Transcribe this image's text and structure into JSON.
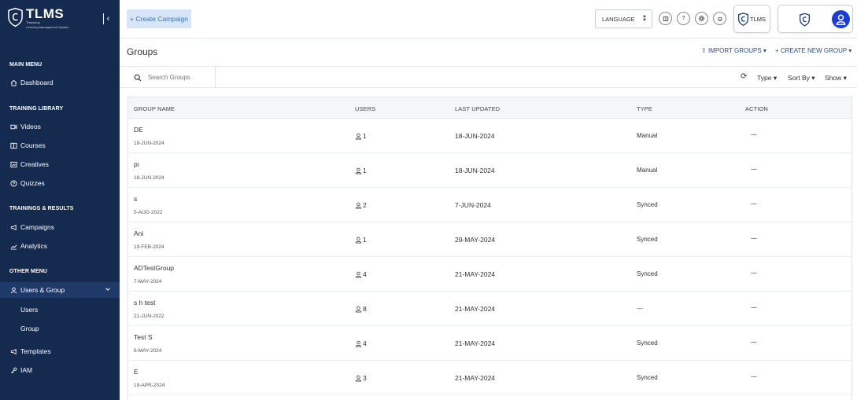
{
  "app": {
    "logo_title": "TLMS",
    "logo_subtitle_1": "Threatcop",
    "logo_subtitle_2": "Learning Management System"
  },
  "sidebar": {
    "sections": [
      {
        "heading": "MAIN MENU"
      },
      {
        "heading": "TRAINING LIBRARY"
      },
      {
        "heading": "TRAININGS & RESULTS"
      },
      {
        "heading": "OTHER MENU"
      }
    ],
    "items": {
      "dashboard": "Dashboard",
      "videos": "Videos",
      "courses": "Courses",
      "creatives": "Creatives",
      "quizzes": "Quizzes",
      "campaigns": "Campaigns",
      "analytics": "Analytics",
      "users_group": "Users & Group",
      "users": "Users",
      "group": "Group",
      "templates": "Templates",
      "iam": "IAM"
    }
  },
  "topbar": {
    "create_campaign": "+ Create Campaign",
    "language": "LANGUAGE",
    "tlms_label": "TLMS"
  },
  "page": {
    "title": "Groups",
    "import_groups": "IMPORT GROUPS",
    "create_new_group": "CREATE NEW GROUP"
  },
  "filters": {
    "search_placeholder": "Search Groups",
    "type": "Type",
    "sort_by": "Sort By",
    "show": "Show"
  },
  "table": {
    "headers": {
      "group_name": "GROUP NAME",
      "users": "USERS",
      "last_updated": "LAST UPDATED",
      "type": "TYPE",
      "action": "ACTION"
    },
    "rows": [
      {
        "name": "DE",
        "created": "18-JUN-2024",
        "users": "1",
        "updated": "18-JUN-2024",
        "type": "Manual",
        "action": "---"
      },
      {
        "name": "pı",
        "created": "18-JUN-2024",
        "users": "1",
        "updated": "18-JUN-2024",
        "type": "Manual",
        "action": "---"
      },
      {
        "name": "s",
        "created": "5-AUG-2022",
        "users": "2",
        "updated": "7-JUN-2024",
        "type": "Synced",
        "action": "---"
      },
      {
        "name": "Ani",
        "created": "19-FEB-2024",
        "users": "1",
        "updated": "29-MAY-2024",
        "type": "Synced",
        "action": "---"
      },
      {
        "name": "ADTestGroup",
        "created": "7-MAY-2024",
        "users": "4",
        "updated": "21-MAY-2024",
        "type": "Synced",
        "action": "---"
      },
      {
        "name": "s       h test",
        "created": "21-JUN-2022",
        "users": "8",
        "updated": "21-MAY-2024",
        "type": "---",
        "action": "---"
      },
      {
        "name": "Test S",
        "created": "6-MAY-2024",
        "users": "4",
        "updated": "21-MAY-2024",
        "type": "Synced",
        "action": "---"
      },
      {
        "name": "E",
        "created": "19-APR-2024",
        "users": "3",
        "updated": "21-MAY-2024",
        "type": "Synced",
        "action": "---"
      }
    ]
  },
  "colors": {
    "sidebar_bg": "#142a4f",
    "active_item_bg": "#1f3a68",
    "accent_blue": "#2b4b8c",
    "avatar_blue": "#1a3cd8",
    "create_btn_bg": "#d6e6f8"
  }
}
